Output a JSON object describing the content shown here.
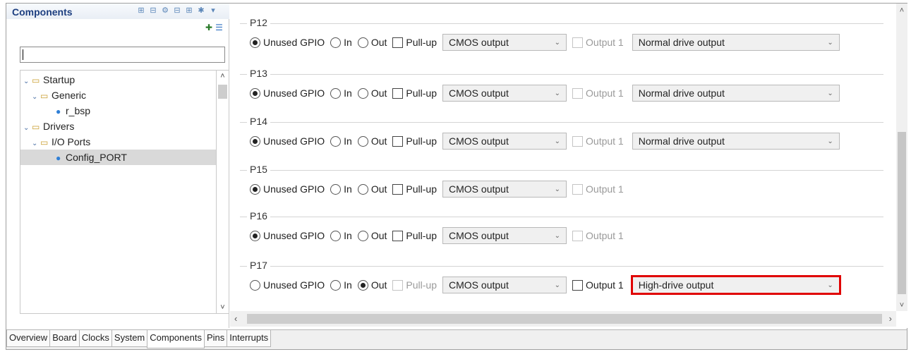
{
  "components_panel": {
    "title": "Components",
    "filter_value": "",
    "tree": [
      {
        "label": "Startup",
        "type": "folder",
        "expanded": true
      },
      {
        "label": "Generic",
        "type": "folder",
        "expanded": true
      },
      {
        "label": "r_bsp",
        "type": "file"
      },
      {
        "label": "Drivers",
        "type": "folder",
        "expanded": true
      },
      {
        "label": "I/O Ports",
        "type": "folder",
        "expanded": true
      },
      {
        "label": "Config_PORT",
        "type": "file",
        "selected": true
      }
    ]
  },
  "port_settings": {
    "radio_labels": {
      "unused": "Unused GPIO",
      "in": "In",
      "out": "Out"
    },
    "pullup_label": "Pull-up",
    "output1_label": "Output 1",
    "groups": [
      {
        "name": "P12",
        "mode": "unused",
        "pullup_enabled": true,
        "output_type": "CMOS output",
        "output1_enabled": false,
        "drive": "Normal drive output"
      },
      {
        "name": "P13",
        "mode": "unused",
        "pullup_enabled": true,
        "output_type": "CMOS output",
        "output1_enabled": false,
        "drive": "Normal drive output"
      },
      {
        "name": "P14",
        "mode": "unused",
        "pullup_enabled": true,
        "output_type": "CMOS output",
        "output1_enabled": false,
        "drive": "Normal drive output"
      },
      {
        "name": "P15",
        "mode": "unused",
        "pullup_enabled": true,
        "output_type": "CMOS output",
        "output1_enabled": false,
        "drive": ""
      },
      {
        "name": "P16",
        "mode": "unused",
        "pullup_enabled": true,
        "output_type": "CMOS output",
        "output1_enabled": false,
        "drive": ""
      },
      {
        "name": "P17",
        "mode": "out",
        "pullup_enabled": false,
        "output_type": "CMOS output",
        "output1_enabled": true,
        "drive": "High-drive output",
        "highlight": true
      }
    ]
  },
  "bottom_tabs": [
    "Overview",
    "Board",
    "Clocks",
    "System",
    "Components",
    "Pins",
    "Interrupts"
  ],
  "active_tab": "Components",
  "colors": {
    "highlight": "#e00000",
    "title": "#1d3f80",
    "selection": "#d9d9d9"
  }
}
